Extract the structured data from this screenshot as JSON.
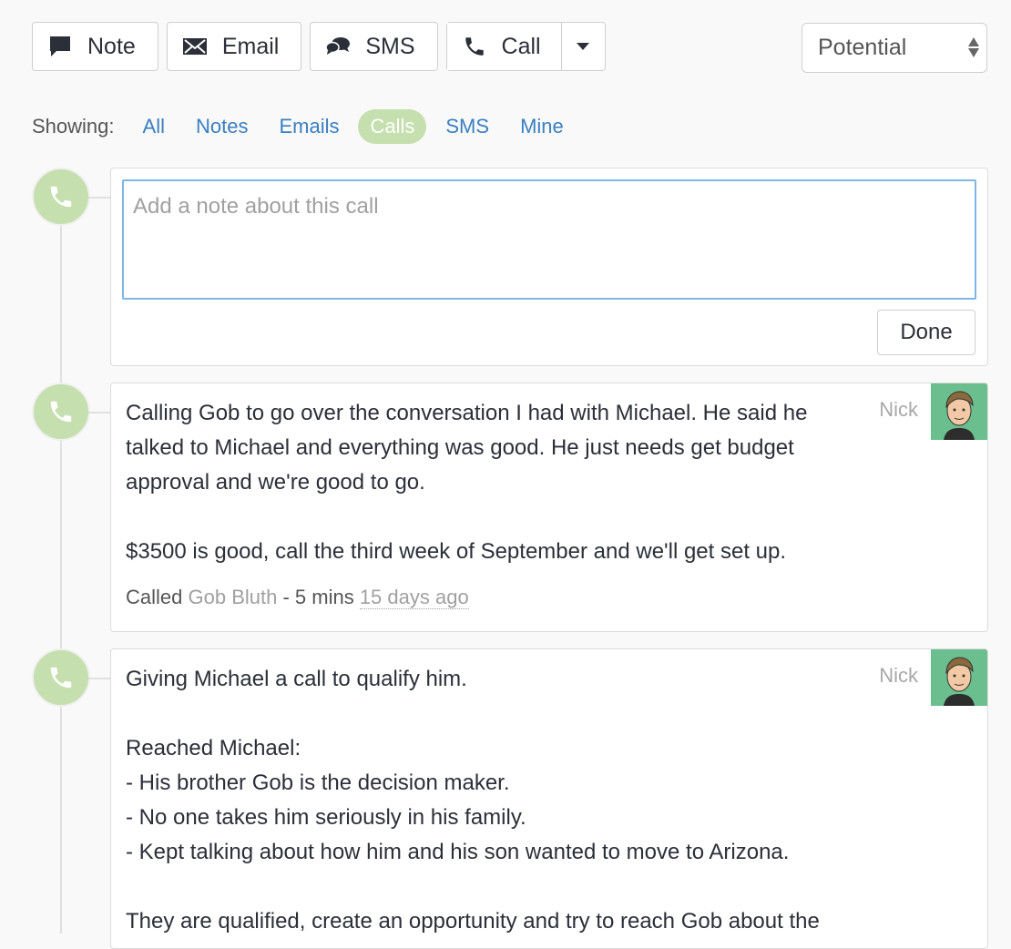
{
  "toolbar": {
    "note_label": "Note",
    "email_label": "Email",
    "sms_label": "SMS",
    "call_label": "Call"
  },
  "status": {
    "selected": "Potential"
  },
  "filters": {
    "label": "Showing:",
    "items": [
      {
        "label": "All",
        "active": false
      },
      {
        "label": "Notes",
        "active": false
      },
      {
        "label": "Emails",
        "active": false
      },
      {
        "label": "Calls",
        "active": true
      },
      {
        "label": "SMS",
        "active": false
      },
      {
        "label": "Mine",
        "active": false
      }
    ]
  },
  "compose": {
    "placeholder": "Add a note about this call",
    "value": "",
    "done_label": "Done"
  },
  "colors": {
    "accent_green": "#c5dfae",
    "link_blue": "#3a7fc1",
    "focus_blue": "#7fb6e6"
  },
  "entries": [
    {
      "author": "Nick",
      "body": "Calling Gob to go over the conversation I had with Michael. He said he talked to Michael and everything was good. He just needs get budget approval and we're good to go.\n\n$3500 is good, call the third week of September and we'll get set up.",
      "meta_prefix": "Called",
      "contact": "Gob Bluth",
      "duration": " - 5 mins ",
      "ago": "15 days ago"
    },
    {
      "author": "Nick",
      "body": "Giving Michael a call to qualify him.\n\nReached Michael:\n- His brother Gob is the decision maker.\n- No one takes him seriously in his family.\n- Kept talking about how him and his son wanted to move to Arizona.\n\nThey are qualified, create an opportunity and try to reach Gob about the"
    }
  ]
}
